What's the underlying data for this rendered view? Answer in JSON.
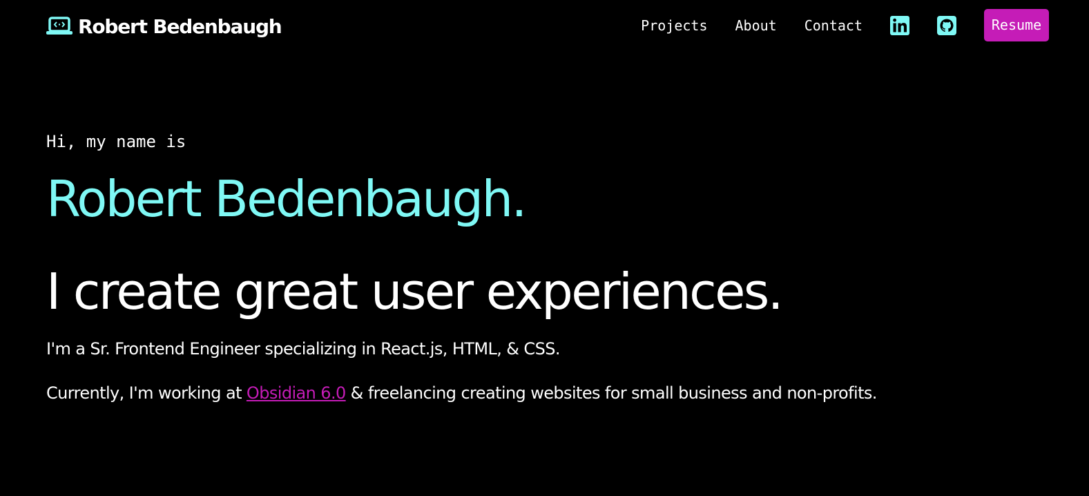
{
  "header": {
    "brand_name": "Robert Bedenbaugh",
    "brand_icon": "laptop-code-icon",
    "nav": [
      {
        "label": "Projects"
      },
      {
        "label": "About"
      },
      {
        "label": "Contact"
      }
    ],
    "social": [
      {
        "icon": "linkedin-icon"
      },
      {
        "icon": "github-icon"
      }
    ],
    "resume_label": "Resume"
  },
  "hero": {
    "greeting": "Hi, my name is",
    "name": "Robert Bedenbaugh.",
    "tagline": "I create great user experiences.",
    "bio": "I'm a Sr. Frontend Engineer specializing in React.js, HTML, & CSS.",
    "current_prefix": "Currently, I'm working at ",
    "employer": "Obsidian 6.0",
    "current_suffix": " & freelancing creating websites for small business and non-profits."
  },
  "colors": {
    "background": "#000000",
    "accent_cyan": "#7ff8f5",
    "accent_magenta": "#c51cb7",
    "text": "#ffffff"
  }
}
